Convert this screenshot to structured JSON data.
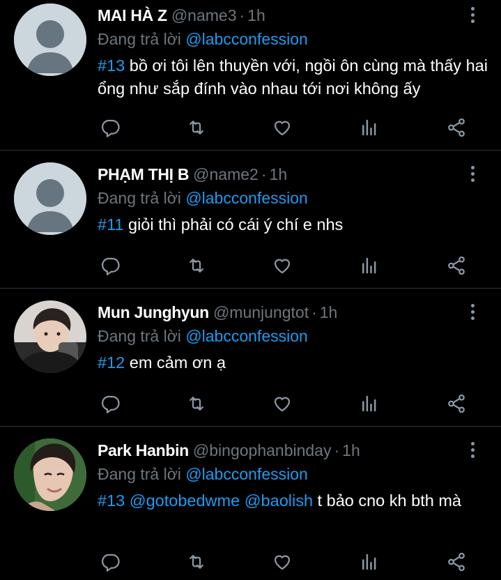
{
  "colors": {
    "background": "#000000",
    "accent": "#1d9bf0",
    "muted": "#6e767d",
    "divider": "#2f3336"
  },
  "icons": [
    "reply-icon",
    "retweet-icon",
    "like-icon",
    "analytics-icon",
    "share-icon",
    "more-icon"
  ],
  "tweets": [
    {
      "name": "MAI HÀ Z",
      "handle": "@name3",
      "time": "1h",
      "replying_label": "Đang trả lời",
      "replying_to": "@labcconfession",
      "tag": "#13",
      "body": " bồ ơi tôi lên thuyền với, ngồi ôn cùng mà thấy hai ổng như sắp đính vào nhau tới nơi không ấy"
    },
    {
      "name": "PHẠM THỊ B",
      "handle": "@name2",
      "time": "1h",
      "replying_label": "Đang trả lời",
      "replying_to": "@labcconfession",
      "tag": "#11",
      "body": " giỏi thì phải có cái ý chí e nhs"
    },
    {
      "name": "Mun Junghyun",
      "handle": "@munjungtot",
      "time": "1h",
      "replying_label": "Đang trả lời",
      "replying_to": "@labcconfession",
      "tag": "#12",
      "body": " em cảm ơn ạ"
    },
    {
      "name": "Park Hanbin",
      "handle": "@bingophanbinday",
      "time": "1h",
      "replying_label": "Đang trả lời",
      "replying_to": "@labcconfession",
      "tag": "#13",
      "mention1": " @gotobedwme",
      "mention2": " @baolish",
      "body": " t bảo cno kh bth mà"
    }
  ]
}
